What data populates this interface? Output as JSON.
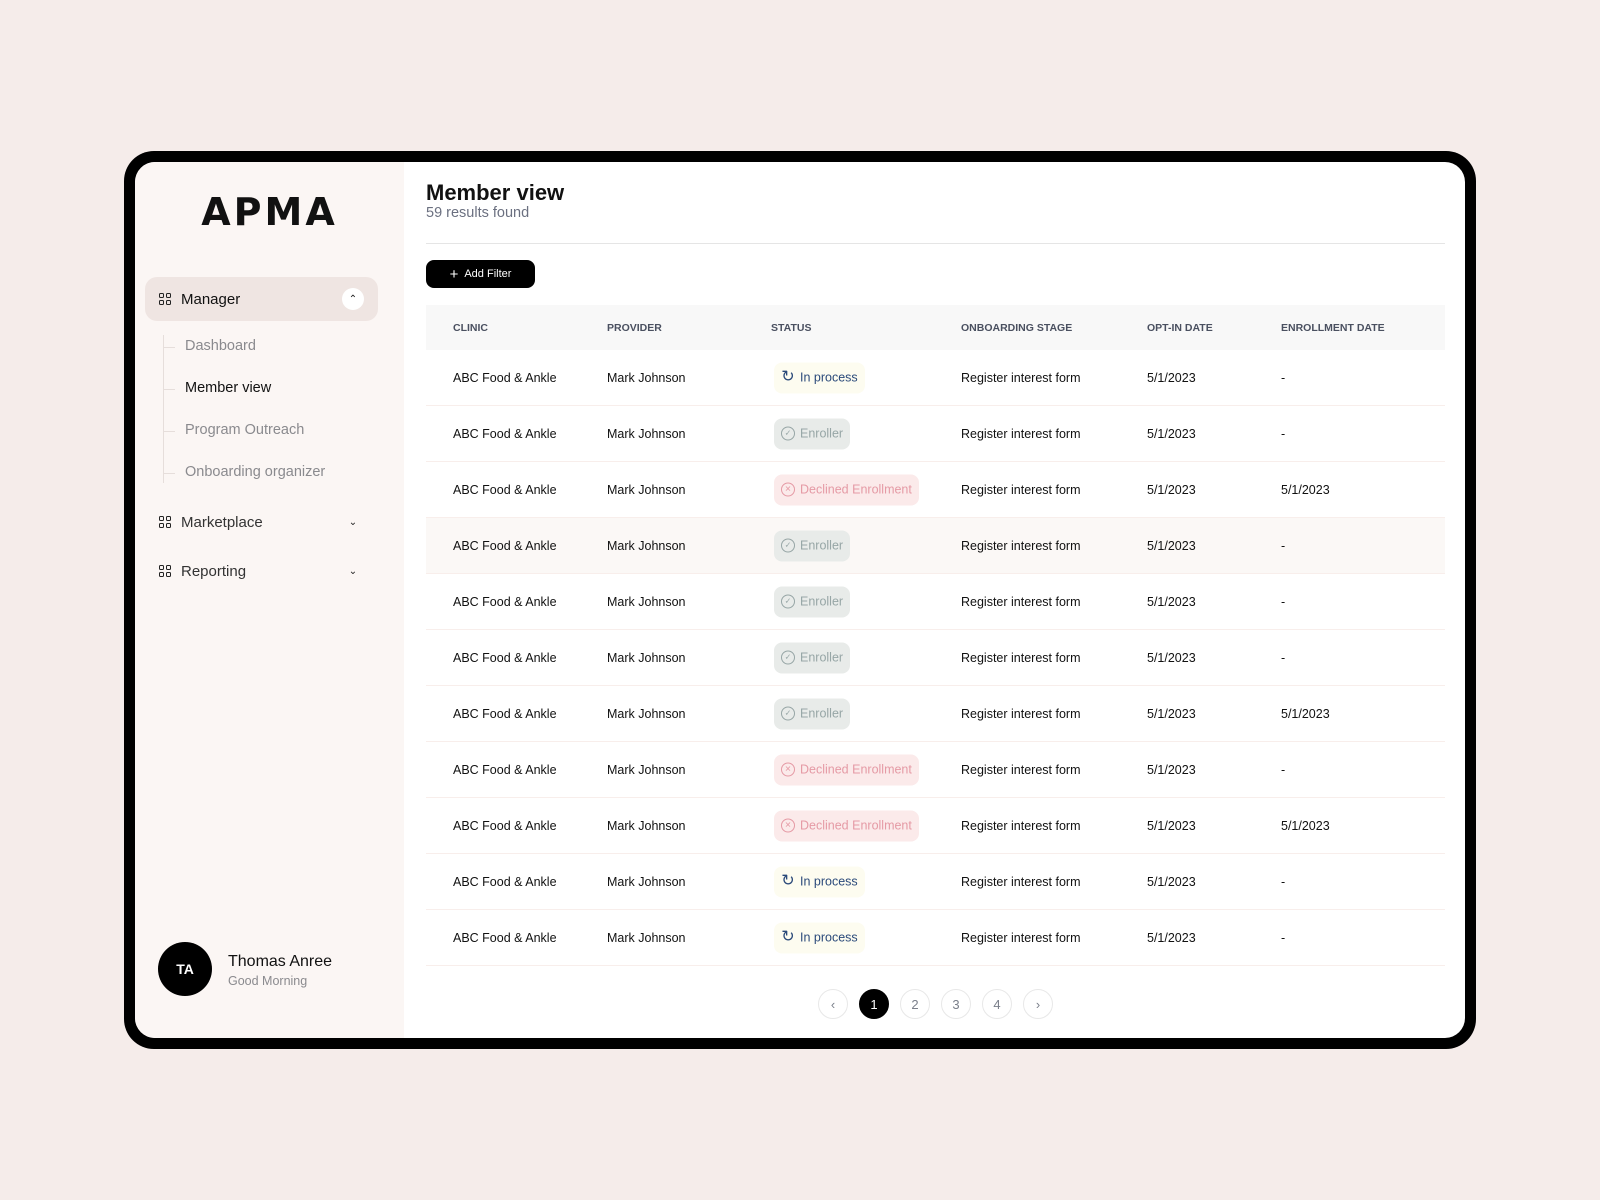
{
  "brand": {
    "logo": "APMA"
  },
  "sidebar": {
    "sections": [
      {
        "label": "Manager",
        "icon": "grid-icon",
        "expanded": true,
        "items": [
          {
            "label": "Dashboard"
          },
          {
            "label": "Member view",
            "active": true
          },
          {
            "label": "Program Outreach"
          },
          {
            "label": "Onboarding organizer"
          }
        ]
      },
      {
        "label": "Marketplace",
        "icon": "grid-icon",
        "expanded": false
      },
      {
        "label": "Reporting",
        "icon": "grid-icon",
        "expanded": false
      }
    ],
    "user": {
      "initials": "TA",
      "name": "Thomas Anree",
      "greeting": "Good Morning"
    }
  },
  "main": {
    "title": "Member view",
    "subtitle": "59 results found",
    "add_filter": "Add Filter",
    "columns": [
      "CLINIC",
      "PROVIDER",
      "STATUS",
      "ONBOARDING STAGE",
      "OPT-IN DATE",
      "ENROLLMENT DATE"
    ],
    "rows": [
      [
        "ABC Food & Ankle",
        "Mark Johnson",
        "In process",
        "Register interest form",
        "5/1/2023",
        "-"
      ],
      [
        "ABC Food & Ankle",
        "Mark Johnson",
        "Enroller",
        "Register interest form",
        "5/1/2023",
        "-"
      ],
      [
        "ABC Food & Ankle",
        "Mark Johnson",
        "Declined Enrollment",
        "Register interest form",
        "5/1/2023",
        "5/1/2023"
      ],
      [
        "ABC Food & Ankle",
        "Mark Johnson",
        "Enroller",
        "Register interest form",
        "5/1/2023",
        "-"
      ],
      [
        "ABC Food & Ankle",
        "Mark Johnson",
        "Enroller",
        "Register interest form",
        "5/1/2023",
        "-"
      ],
      [
        "ABC Food & Ankle",
        "Mark Johnson",
        "Enroller",
        "Register interest form",
        "5/1/2023",
        "-"
      ],
      [
        "ABC Food & Ankle",
        "Mark Johnson",
        "Enroller",
        "Register interest form",
        "5/1/2023",
        "5/1/2023"
      ],
      [
        "ABC Food & Ankle",
        "Mark Johnson",
        "Declined Enrollment",
        "Register interest form",
        "5/1/2023",
        "-"
      ],
      [
        "ABC Food & Ankle",
        "Mark Johnson",
        "Declined Enrollment",
        "Register interest form",
        "5/1/2023",
        "5/1/2023"
      ],
      [
        "ABC Food & Ankle",
        "Mark Johnson",
        "In process",
        "Register interest form",
        "5/1/2023",
        "-"
      ],
      [
        "ABC Food & Ankle",
        "Mark Johnson",
        "In process",
        "Register interest form",
        "5/1/2023",
        "-"
      ]
    ],
    "status_colors": {
      "In process": "#2b4a7a",
      "Enroller": "#97a6a6",
      "Declined Enrollment": "#e59aa5"
    },
    "pagination": {
      "prev": "‹",
      "pages": [
        "1",
        "2",
        "3",
        "4"
      ],
      "current": "1",
      "next": "›"
    }
  }
}
